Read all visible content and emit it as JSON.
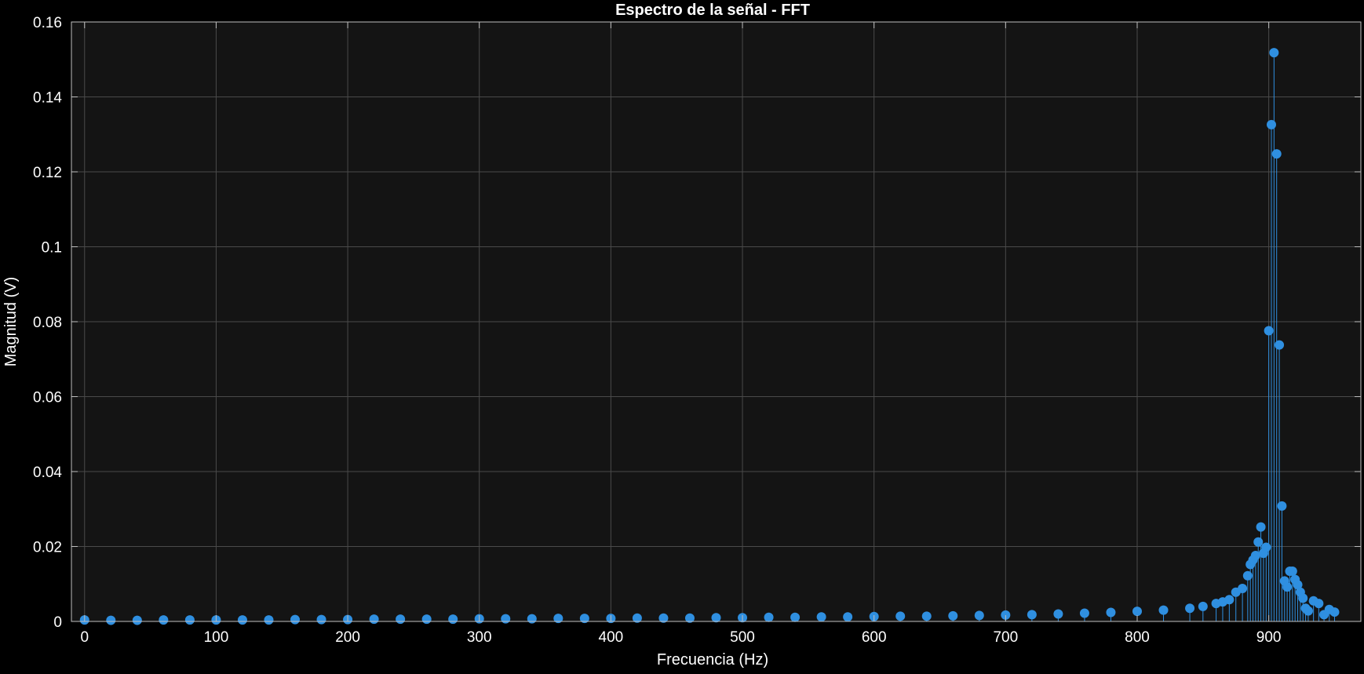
{
  "chart_data": {
    "type": "stem",
    "title": "Espectro de la señal - FFT",
    "xlabel": "Frecuencia (Hz)",
    "ylabel": "Magnitud (V)",
    "xlim": [
      -10,
      970
    ],
    "ylim": [
      0,
      0.16
    ],
    "xticks": [
      0,
      100,
      200,
      300,
      400,
      500,
      600,
      700,
      800,
      900
    ],
    "yticks": [
      0,
      0.02,
      0.04,
      0.06,
      0.08,
      0.1,
      0.12,
      0.14,
      0.16
    ],
    "xtick_labels": [
      "0",
      "100",
      "200",
      "300",
      "400",
      "500",
      "600",
      "700",
      "800",
      "900"
    ],
    "ytick_labels": [
      "0",
      "0.02",
      "0.04",
      "0.06",
      "0.08",
      "0.1",
      "0.12",
      "0.14",
      "0.16"
    ],
    "grid": true,
    "colors": {
      "background": "#141414",
      "figure": "#000000",
      "series": "#2f8fe0",
      "grid": "#4a4a4a",
      "text": "#ffffff"
    },
    "series": [
      {
        "x": [
          0,
          20,
          40,
          60,
          80,
          100,
          120,
          140,
          160,
          180,
          200,
          220,
          240,
          260,
          280,
          300,
          320,
          340,
          360,
          380,
          400,
          420,
          440,
          460,
          480,
          500,
          520,
          540,
          560,
          580,
          600,
          620,
          640,
          660,
          680,
          700,
          720,
          740,
          760,
          780,
          800,
          820,
          840,
          850,
          860,
          865,
          870,
          875,
          880,
          884,
          886,
          888,
          890,
          892,
          894,
          896,
          898,
          900,
          902,
          904,
          906,
          908,
          910,
          912,
          914,
          916,
          918,
          920,
          922,
          924,
          926,
          928,
          930,
          934,
          938,
          942,
          946,
          950
        ],
        "y": [
          0.0004,
          0.0003,
          0.0003,
          0.0004,
          0.0004,
          0.0004,
          0.0004,
          0.0004,
          0.0005,
          0.0005,
          0.0005,
          0.0006,
          0.0006,
          0.0006,
          0.0006,
          0.0007,
          0.0007,
          0.0007,
          0.0008,
          0.0008,
          0.0008,
          0.0009,
          0.0009,
          0.0009,
          0.001,
          0.001,
          0.0011,
          0.0011,
          0.0012,
          0.0012,
          0.0013,
          0.0014,
          0.0014,
          0.0015,
          0.0016,
          0.0017,
          0.0018,
          0.002,
          0.0022,
          0.0024,
          0.0027,
          0.003,
          0.0035,
          0.004,
          0.0048,
          0.0052,
          0.0058,
          0.0078,
          0.0088,
          0.0122,
          0.0152,
          0.0164,
          0.0176,
          0.0212,
          0.0252,
          0.0182,
          0.0198,
          0.0776,
          0.1326,
          0.1518,
          0.1248,
          0.0738,
          0.0308,
          0.0108,
          0.0092,
          0.0134,
          0.0134,
          0.0112,
          0.0098,
          0.0078,
          0.0062,
          0.0035,
          0.0028,
          0.0055,
          0.0048,
          0.0018,
          0.0032,
          0.0025
        ]
      }
    ]
  }
}
